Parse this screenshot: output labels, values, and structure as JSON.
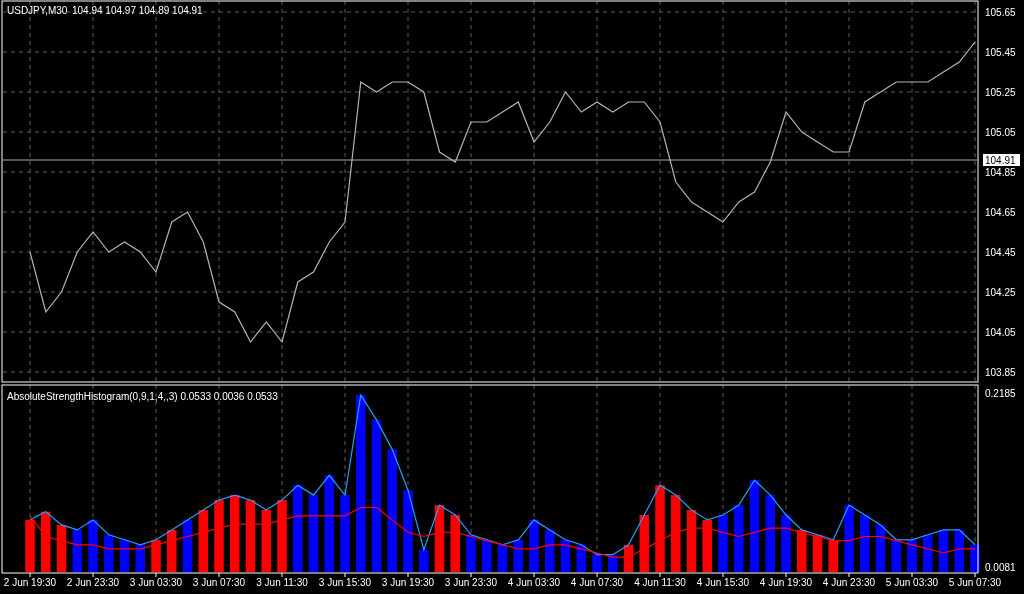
{
  "price_panel": {
    "symbol": "USDJPY,M30",
    "ohlc": [
      "104.94",
      "104.97",
      "104.89",
      "104.91"
    ],
    "chart_data": {
      "type": "line",
      "grid": true,
      "ylim": [
        103.85,
        105.65
      ],
      "yticks": [
        105.65,
        105.45,
        105.25,
        105.05,
        104.85,
        104.65,
        104.45,
        104.25,
        104.05,
        103.85
      ],
      "ref_lines": [
        {
          "axis": "y",
          "value": 104.91,
          "label": "104.91"
        }
      ],
      "series": [
        {
          "color": "#b4b4b4",
          "values": [
            104.45,
            104.15,
            104.25,
            104.45,
            104.55,
            104.45,
            104.5,
            104.45,
            104.35,
            104.6,
            104.65,
            104.5,
            104.2,
            104.15,
            104.0,
            104.1,
            104.0,
            104.3,
            104.35,
            104.5,
            104.6,
            105.3,
            105.25,
            105.3,
            105.3,
            105.25,
            104.95,
            104.9,
            105.1,
            105.1,
            105.15,
            105.2,
            105.0,
            105.1,
            105.25,
            105.15,
            105.2,
            105.15,
            105.2,
            105.2,
            105.1,
            104.8,
            104.7,
            104.65,
            104.6,
            104.7,
            104.75,
            104.9,
            105.15,
            105.05,
            105.0,
            104.95,
            104.95,
            105.2,
            105.25,
            105.3,
            105.3,
            105.3,
            105.35,
            105.4,
            105.5
          ]
        }
      ]
    }
  },
  "indicator_panel": {
    "title": "AbsoluteStrengthHistogram(0,9,1,4,,3) 0.0533 0.0036 0.0533",
    "chart_data": {
      "type": "bar",
      "grid": true,
      "ylim": [
        0.0081,
        0.2185
      ],
      "yticks": [
        0.2185,
        0.0081
      ],
      "categories": [
        "2 Jun 19:30",
        null,
        null,
        null,
        "2 Jun 23:30",
        null,
        null,
        null,
        "3 Jun 03:30",
        null,
        null,
        null,
        "3 Jun 07:30",
        null,
        null,
        null,
        "3 Jun 11:30",
        null,
        null,
        null,
        "3 Jun 15:30",
        null,
        null,
        null,
        "3 Jun 19:30",
        null,
        null,
        null,
        "3 Jun 23:30",
        null,
        null,
        null,
        "4 Jun 03:30",
        null,
        null,
        null,
        "4 Jun 07:30",
        null,
        null,
        null,
        "4 Jun 11:30",
        null,
        null,
        null,
        "4 Jun 15:30",
        null,
        null,
        null,
        "4 Jun 19:30",
        null,
        null,
        null,
        "4 Jun 23:30",
        null,
        null,
        null,
        "5 Jun 03:30",
        null,
        null,
        null,
        "5 Jun 07:30"
      ],
      "series": [
        {
          "color": "#ff0000",
          "values": [
            0.065,
            0.075,
            0.059,
            null,
            null,
            null,
            null,
            null,
            0.041,
            0.053,
            null,
            0.077,
            0.089,
            0.095,
            0.089,
            0.077,
            0.089,
            null,
            null,
            null,
            null,
            null,
            null,
            null,
            null,
            null,
            0.083,
            0.071,
            null,
            null,
            null,
            null,
            null,
            null,
            null,
            null,
            null,
            null,
            0.035,
            0.071,
            0.107,
            0.095,
            0.077,
            0.065,
            null,
            null,
            null,
            null,
            null,
            0.053,
            0.047,
            0.041,
            null,
            null,
            null,
            null,
            null,
            null,
            null,
            null,
            null
          ]
        },
        {
          "color": "#0000ff",
          "values": [
            null,
            null,
            null,
            0.053,
            0.065,
            0.047,
            0.041,
            0.035,
            null,
            null,
            0.065,
            null,
            null,
            null,
            null,
            null,
            null,
            0.107,
            0.095,
            0.119,
            0.095,
            0.216,
            0.186,
            0.15,
            0.101,
            0.029,
            null,
            null,
            0.047,
            0.041,
            0.035,
            0.041,
            0.065,
            0.053,
            0.041,
            0.035,
            0.023,
            0.023,
            null,
            null,
            null,
            null,
            null,
            null,
            0.071,
            0.083,
            0.113,
            0.095,
            0.071,
            null,
            null,
            null,
            0.083,
            0.071,
            0.059,
            0.041,
            0.041,
            0.047,
            0.053,
            0.053,
            0.035
          ]
        }
      ]
    },
    "overlay": {
      "chart_data": {
        "type": "line",
        "ylim": [
          0.0081,
          0.2185
        ],
        "series": [
          {
            "color": "#1ea0ff",
            "values": [
              0.065,
              0.075,
              0.059,
              0.053,
              0.065,
              0.047,
              0.041,
              0.035,
              0.041,
              0.053,
              0.065,
              0.077,
              0.089,
              0.095,
              0.089,
              0.077,
              0.089,
              0.107,
              0.095,
              0.119,
              0.095,
              0.216,
              0.186,
              0.15,
              0.101,
              0.029,
              0.083,
              0.071,
              0.047,
              0.041,
              0.035,
              0.041,
              0.065,
              0.053,
              0.041,
              0.035,
              0.023,
              0.023,
              0.035,
              0.071,
              0.107,
              0.095,
              0.077,
              0.065,
              0.071,
              0.083,
              0.113,
              0.095,
              0.071,
              0.053,
              0.047,
              0.041,
              0.083,
              0.071,
              0.059,
              0.041,
              0.041,
              0.047,
              0.053,
              0.053,
              0.035
            ]
          },
          {
            "color": "#ff0000",
            "values": [
              0.07,
              0.045,
              0.04,
              0.035,
              0.035,
              0.03,
              0.03,
              0.03,
              0.035,
              0.04,
              0.045,
              0.05,
              0.055,
              0.06,
              0.06,
              0.06,
              0.065,
              0.07,
              0.07,
              0.07,
              0.07,
              0.08,
              0.08,
              0.065,
              0.05,
              0.045,
              0.05,
              0.05,
              0.045,
              0.04,
              0.035,
              0.03,
              0.03,
              0.035,
              0.035,
              0.03,
              0.025,
              0.02,
              0.02,
              0.03,
              0.04,
              0.05,
              0.055,
              0.055,
              0.05,
              0.045,
              0.05,
              0.055,
              0.055,
              0.05,
              0.045,
              0.04,
              0.04,
              0.045,
              0.045,
              0.04,
              0.035,
              0.03,
              0.025,
              0.03,
              0.03
            ]
          }
        ]
      }
    }
  }
}
